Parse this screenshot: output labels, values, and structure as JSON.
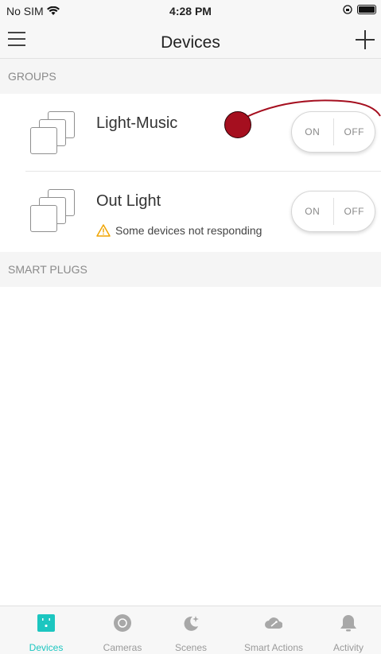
{
  "status_bar": {
    "carrier": "No SIM",
    "time": "4:28 PM"
  },
  "nav": {
    "title": "Devices"
  },
  "sections": {
    "groups_label": "GROUPS",
    "plugs_label": "SMART PLUGS"
  },
  "groups": [
    {
      "name": "Light-Music",
      "on_label": "ON",
      "off_label": "OFF",
      "warning": ""
    },
    {
      "name": "Out Light",
      "on_label": "ON",
      "off_label": "OFF",
      "warning": "Some devices not responding"
    }
  ],
  "tabs": [
    {
      "label": "Devices",
      "icon": "devices-icon",
      "active": true
    },
    {
      "label": "Cameras",
      "icon": "camera-icon",
      "active": false
    },
    {
      "label": "Scenes",
      "icon": "scenes-icon",
      "active": false
    },
    {
      "label": "Smart Actions",
      "icon": "smart-actions-icon",
      "active": false
    },
    {
      "label": "Activity",
      "icon": "bell-icon",
      "active": false
    }
  ],
  "colors": {
    "accent": "#1cc6c0",
    "warning": "#f0a400",
    "touch_marker": "#a50f1f"
  }
}
